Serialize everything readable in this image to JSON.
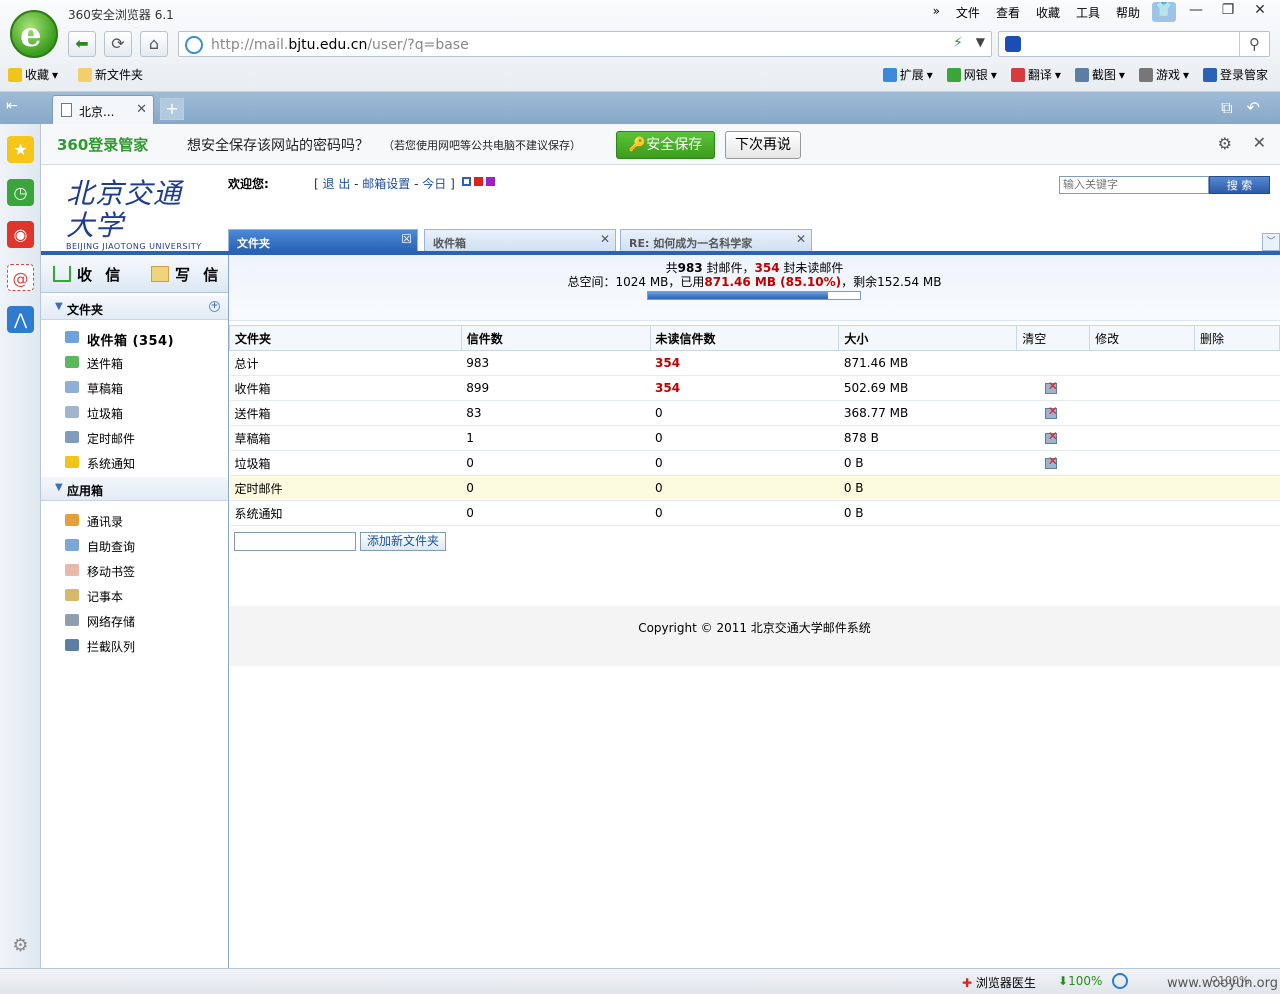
{
  "browser": {
    "window_title": "360安全浏览器 6.1",
    "menu": [
      "»",
      "文件",
      "查看",
      "收藏",
      "工具",
      "帮助"
    ],
    "url_prefix": "http://mail.",
    "url_domain": "bjtu.edu.cn",
    "url_path": "/user/?q=base",
    "bookmarks": [
      "收藏",
      "新文件夹"
    ],
    "toolbar": [
      "扩展",
      "网银",
      "翻译",
      "截图",
      "游戏",
      "登录管家"
    ],
    "tab_label": "北京...",
    "accent": "#2a63b5"
  },
  "password_bar": {
    "brand": "360登录管家",
    "question": "想安全保存该网站的密码吗？",
    "note": "（若您使用网吧等公共电脑不建议保存）",
    "save_label": "安全保存",
    "later_label": "下次再说"
  },
  "mail_header": {
    "logo_cn": "北京交通大学",
    "logo_en": "BEIJING JIAOTONG UNIVERSITY",
    "welcome": "欢迎您:",
    "links": {
      "logout": "退 出",
      "settings": "邮箱设置",
      "today": "今日"
    },
    "search_placeholder": "输入关键字",
    "search_button": "搜 索"
  },
  "mail_tabs": [
    {
      "label": "文件夹",
      "active": true
    },
    {
      "label": "收件箱",
      "active": false
    },
    {
      "label": "RE: 如何成为一名科学家",
      "active": false
    }
  ],
  "sidebar": {
    "receive": "收 信",
    "compose": "写 信",
    "folders_title": "文件夹",
    "folders": [
      "收件箱 (354)",
      "送件箱",
      "草稿箱",
      "垃圾箱",
      "定时邮件",
      "系统通知"
    ],
    "apps_title": "应用箱",
    "apps": [
      "通讯录",
      "自助查询",
      "移动书签",
      "记事本",
      "网络存储",
      "拦截队列"
    ]
  },
  "summary": {
    "total_prefix": "共",
    "total_mails": "983",
    "mails_unit": " 封邮件，",
    "unread": "354",
    "unread_suffix": " 封未读邮件",
    "space_prefix": "总空间：1024 MB，已用",
    "used": "871.46 MB (85.10%)",
    "remaining": "，剩余152.54 MB",
    "used_fraction": 0.851
  },
  "table": {
    "headers": [
      "文件夹",
      "信件数",
      "未读信件数",
      "大小",
      "清空",
      "修改",
      "删除"
    ],
    "rows": [
      {
        "name": "总计",
        "count": "983",
        "unread": "354",
        "size": "871.46 MB",
        "clear": false
      },
      {
        "name": "收件箱",
        "count": "899",
        "unread": "354",
        "size": "502.69 MB",
        "clear": true
      },
      {
        "name": "送件箱",
        "count": "83",
        "unread": "0",
        "size": "368.77 MB",
        "clear": true
      },
      {
        "name": "草稿箱",
        "count": "1",
        "unread": "0",
        "size": "878 B",
        "clear": true
      },
      {
        "name": "垃圾箱",
        "count": "0",
        "unread": "0",
        "size": "0 B",
        "clear": true
      },
      {
        "name": "定时邮件",
        "count": "0",
        "unread": "0",
        "size": "0 B",
        "clear": false
      },
      {
        "name": "系统通知",
        "count": "0",
        "unread": "0",
        "size": "0 B",
        "clear": false
      }
    ]
  },
  "add_folder_label": "添加新文件夹",
  "footer": "Copyright © 2011 北京交通大学邮件系统",
  "statusbar": {
    "doctor": "浏览器医生",
    "download": "100%",
    "zoom": "100%",
    "watermark": "www.wooyun.org"
  }
}
